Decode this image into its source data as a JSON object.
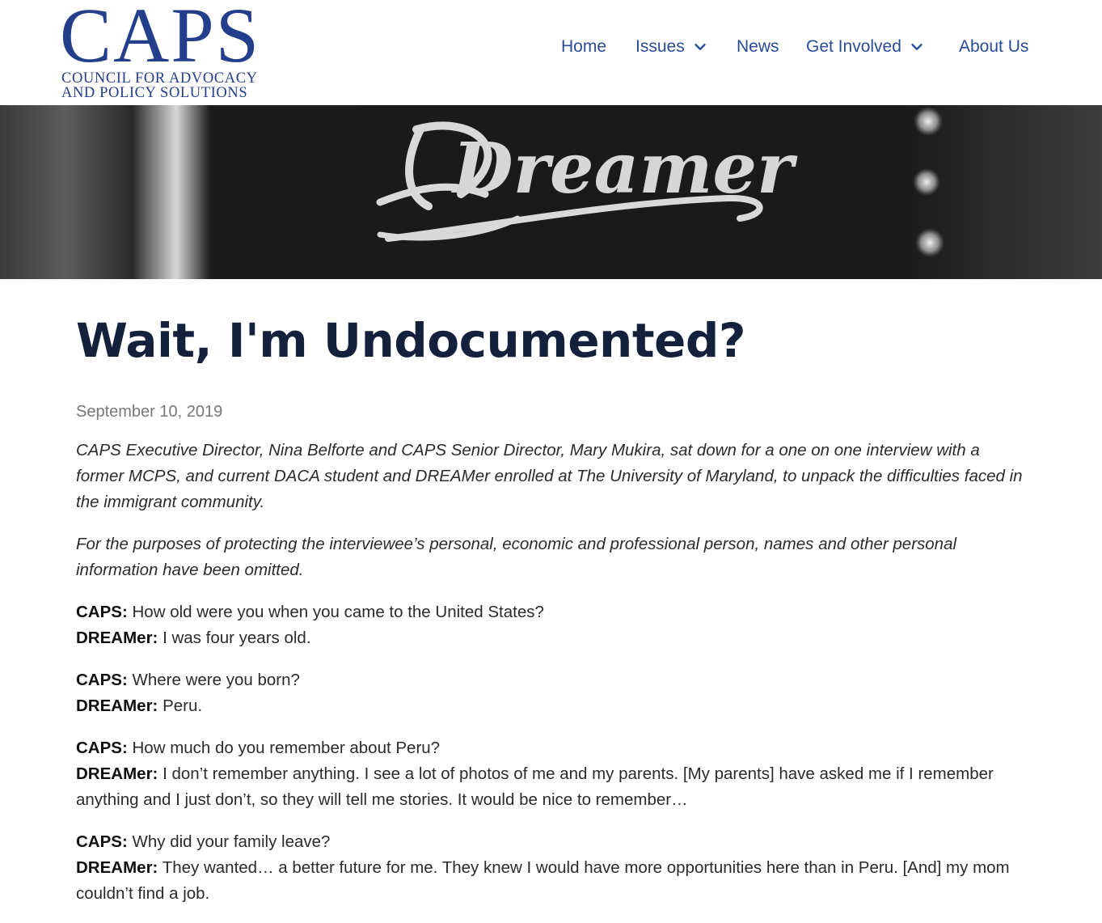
{
  "header": {
    "logo": {
      "wordmark": "CAPS",
      "line1": "COUNCIL FOR ADVOCACY",
      "line2": "AND POLICY SOLUTIONS"
    },
    "nav": [
      {
        "label": "Home",
        "has_dropdown": false
      },
      {
        "label": "Issues",
        "has_dropdown": true
      },
      {
        "label": "News",
        "has_dropdown": false
      },
      {
        "label": "Get Involved",
        "has_dropdown": true
      },
      {
        "label": "About Us",
        "has_dropdown": false
      }
    ]
  },
  "hero": {
    "embroidered_text": "Dreamer"
  },
  "article": {
    "title": "Wait, I'm Undocumented?",
    "date": "September 10, 2019",
    "intro": [
      "CAPS Executive Director, Nina Belforte and CAPS Senior Director, Mary Mukira, sat down for a one on one interview with a former MCPS, and current DACA student and DREAMer enrolled at The University of Maryland, to unpack the difficulties faced in the immigrant community.",
      "For the purposes of protecting the interviewee’s personal, economic and professional person, names and other personal information have been omitted."
    ],
    "qa": [
      {
        "q_speaker": "CAPS:",
        "q": "How old were you when you came to the United States?",
        "a_speaker": "DREAMer:",
        "a": "I was four years old."
      },
      {
        "q_speaker": "CAPS:",
        "q": "Where were you born?",
        "a_speaker": "DREAMer:",
        "a": "Peru."
      },
      {
        "q_speaker": "CAPS:",
        "q": "How much do you remember about Peru?",
        "a_speaker": "DREAMer:",
        "a": "I don’t remember anything. I see a lot of photos of me and my parents. [My parents] have asked me if I remember anything and I just don’t, so they will tell me stories. It would be nice to remember…"
      },
      {
        "q_speaker": "CAPS:",
        "q": "Why did your family leave?",
        "a_speaker": "DREAMer:",
        "a": "They wanted… a better future for me. They knew I would have more opportunities here than in Peru. [And] my mom couldn’t find a job."
      }
    ]
  },
  "colors": {
    "brand_blue": "#233e8b",
    "brand_red": "#a8343a",
    "nav_blue": "#2a4c97",
    "title_navy": "#14213d"
  }
}
